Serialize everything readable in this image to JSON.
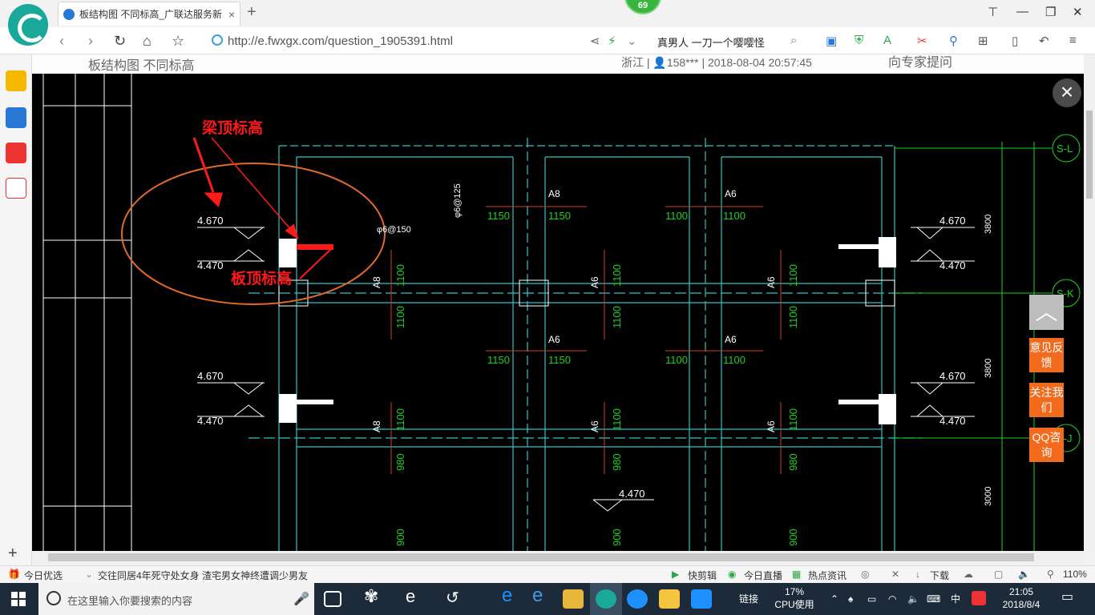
{
  "browser": {
    "tab_title": "板结构图 不同标高_广联达服务新",
    "tab_close": "×",
    "new_tab": "+",
    "badge": "69",
    "url": "http://e.fwxgx.com/question_1905391.html",
    "search_hint": "真男人 一刀一个嘤嘤怪",
    "window_controls": [
      "⊤",
      "—",
      "❐",
      "✕"
    ]
  },
  "page": {
    "title": "板结构图 不同标高",
    "meta": "浙江 | 👤158*** | 2018-08-04 20:57:45",
    "right_text": "向专家提问"
  },
  "annotations": {
    "beam_top": "梁顶标高",
    "slab_top": "板顶标高"
  },
  "drawing": {
    "elevations": [
      "4.670",
      "4.470",
      "4.670",
      "4.470",
      "4.670",
      "4.470",
      "4.670",
      "4.470",
      "4.470"
    ],
    "axes": [
      "S-L",
      "S-K",
      "S-J"
    ],
    "rebar_note_1": "φ6@150",
    "rebar_note_2": "φ6@125",
    "labels_top": [
      "A8",
      "A6",
      "A6",
      "A6"
    ],
    "dims_row1": [
      "1150",
      "1150",
      "1100",
      "1100"
    ],
    "dims_row2": [
      "1150",
      "1150",
      "1100",
      "1100"
    ],
    "dims_vertical": [
      "3800",
      "3800",
      "3000"
    ],
    "side_labels": [
      "A8",
      "A6",
      "A6",
      "A8",
      "A6",
      "A6"
    ],
    "vert_dims": [
      "1100",
      "1100",
      "1100",
      "1100",
      "1100",
      "1100",
      "1100",
      "980",
      "1100",
      "980",
      "1100",
      "980",
      "900",
      "900",
      "900"
    ]
  },
  "float_menu": {
    "feedback": "意见反馈",
    "follow": "关注我们",
    "qq": "QQ咨询",
    "top": "︿"
  },
  "statusbar": {
    "today_pick": "今日优选",
    "news": "交往同居4年死守处女身 渣宅男女神终遭调少男友",
    "quick_cut": "快剪辑",
    "live": "今日直播",
    "hot": "热点资讯",
    "download": "下载",
    "zoom": "110%"
  },
  "taskbar": {
    "search_placeholder": "在这里输入你要搜索的内容",
    "links": "链接",
    "cpu_percent": "17%",
    "cpu_label": "CPU使用",
    "ime": "中",
    "time": "21:05",
    "date": "2018/8/4"
  },
  "colors": {
    "annotation_red": "#ff1a1a",
    "circle_orange": "#e06a2a",
    "cad_cyan": "#2ec4c4",
    "cad_green": "#19d419",
    "accent_orange": "#f26b1d"
  }
}
